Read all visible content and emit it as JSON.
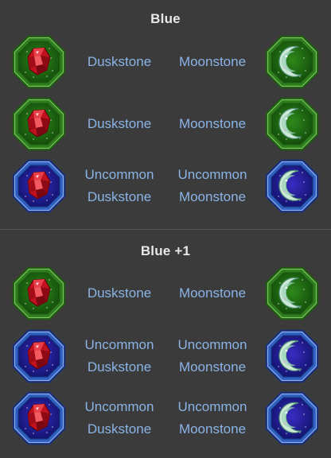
{
  "colors": {
    "background": "#3b3b3b",
    "title": "#e8e8e8",
    "item_text": "#8ab4e6",
    "common_frame": "#2e7d1e",
    "uncommon_frame": "#2f5fbf"
  },
  "sections": [
    {
      "title": "Blue",
      "rows": [
        {
          "rarity": "common",
          "left": {
            "icon": "red-gem-icon",
            "prefix": "",
            "name": "Duskstone"
          },
          "right": {
            "icon": "moon-icon",
            "prefix": "",
            "name": "Moonstone"
          }
        },
        {
          "rarity": "common",
          "left": {
            "icon": "red-gem-icon",
            "prefix": "",
            "name": "Duskstone"
          },
          "right": {
            "icon": "moon-icon",
            "prefix": "",
            "name": "Moonstone"
          }
        },
        {
          "rarity": "uncommon",
          "left": {
            "icon": "red-gem-icon",
            "prefix": "Uncommon",
            "name": "Duskstone"
          },
          "right": {
            "icon": "moon-icon",
            "prefix": "Uncommon",
            "name": "Moonstone"
          }
        }
      ]
    },
    {
      "title": "Blue +1",
      "rows": [
        {
          "rarity": "common",
          "left": {
            "icon": "red-gem-icon",
            "prefix": "",
            "name": "Duskstone"
          },
          "right": {
            "icon": "moon-icon",
            "prefix": "",
            "name": "Moonstone"
          }
        },
        {
          "rarity": "uncommon",
          "left": {
            "icon": "red-gem-icon",
            "prefix": "Uncommon",
            "name": "Duskstone"
          },
          "right": {
            "icon": "moon-icon",
            "prefix": "Uncommon",
            "name": "Moonstone"
          }
        },
        {
          "rarity": "uncommon",
          "left": {
            "icon": "red-gem-icon",
            "prefix": "Uncommon",
            "name": "Duskstone"
          },
          "right": {
            "icon": "moon-icon",
            "prefix": "Uncommon",
            "name": "Moonstone"
          }
        }
      ]
    }
  ]
}
